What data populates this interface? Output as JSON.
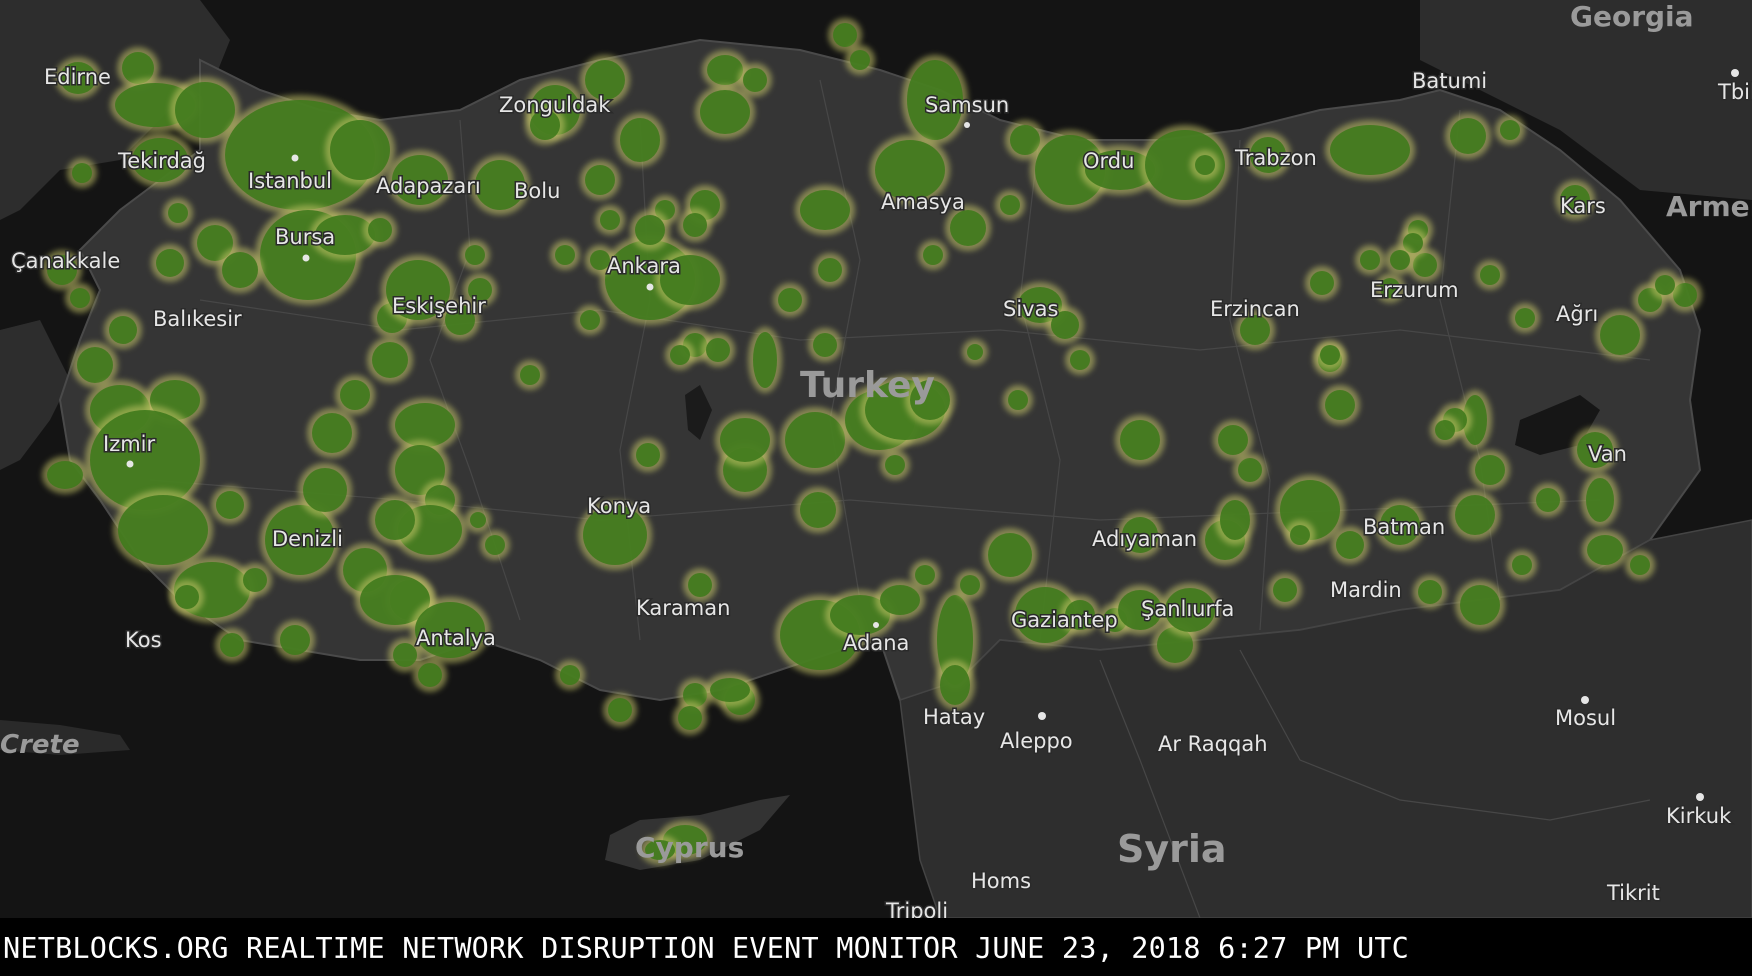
{
  "caption": "NETBLOCKS.ORG REALTIME NETWORK DISRUPTION EVENT MONITOR JUNE 23, 2018 6:27 PM UTC",
  "colors": {
    "sea": "#141414",
    "land": "#2f2f2f",
    "turkey_land": "#343434",
    "border": "#4a4a4a",
    "blob_fill": "#3f7a1c",
    "blob_glow": "#c9c96a",
    "caption_bg": "#000000",
    "caption_text": "#ffffff"
  },
  "country_label": "Turkey",
  "region_labels": [
    "Georgia",
    "Armen",
    "Syria",
    "Crete",
    "Cyprus"
  ],
  "city_labels": [
    "Edirne",
    "Tekirdağ",
    "Istanbul",
    "Adapazarı",
    "Zonguldak",
    "Bolu",
    "Samsun",
    "Ordu",
    "Trabzon",
    "Batumi",
    "Tbili",
    "Kars",
    "Çanakkale",
    "Bursa",
    "Balıkesir",
    "Eskişehir",
    "Ankara",
    "Amasya",
    "Sivas",
    "Erzincan",
    "Erzurum",
    "Ağrı",
    "Izmir",
    "Denizli",
    "Konya",
    "Adıyaman",
    "Batman",
    "Van",
    "Kos",
    "Antalya",
    "Karaman",
    "Adana",
    "Gaziantep",
    "Şanlıurfa",
    "Mardin",
    "Hatay",
    "Aleppo",
    "Ar Raqqah",
    "Mosul",
    "Kirkuk",
    "Homs",
    "Tripoli",
    "Tikrit"
  ]
}
